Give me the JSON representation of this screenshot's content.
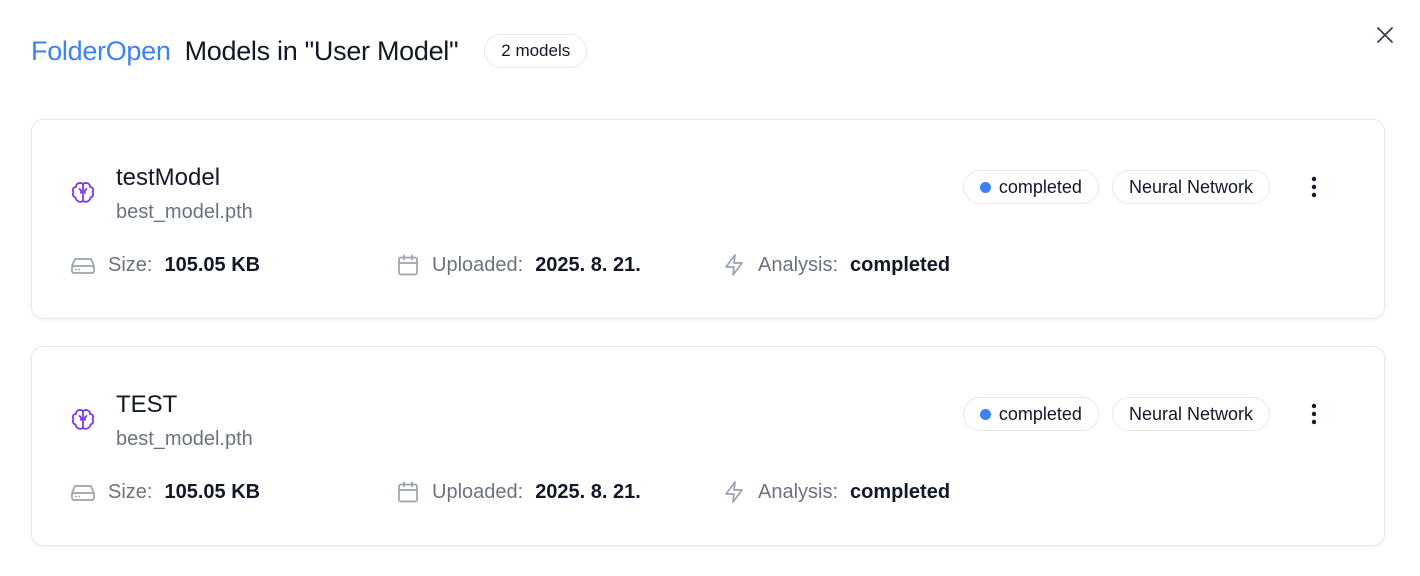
{
  "header": {
    "folder_label": "FolderOpen",
    "title": "Models in \"User Model\"",
    "count_badge": "2 models"
  },
  "icons": {
    "close": "close-icon",
    "brain": "brain-icon",
    "size": "hard-drive-icon",
    "uploaded": "calendar-icon",
    "analysis": "lightning-icon",
    "more": "more-vertical-icon"
  },
  "colors": {
    "accent": "#3b82f6",
    "brain": "#7c3aed",
    "status_dot": "#3b82f6"
  },
  "models": [
    {
      "name": "testModel",
      "file": "best_model.pth",
      "status": "completed",
      "type": "Neural Network",
      "size_label": "Size:",
      "size": "105.05 KB",
      "uploaded_label": "Uploaded:",
      "uploaded": "2025. 8. 21.",
      "analysis_label": "Analysis:",
      "analysis": "completed"
    },
    {
      "name": "TEST",
      "file": "best_model.pth",
      "status": "completed",
      "type": "Neural Network",
      "size_label": "Size:",
      "size": "105.05 KB",
      "uploaded_label": "Uploaded:",
      "uploaded": "2025. 8. 21.",
      "analysis_label": "Analysis:",
      "analysis": "completed"
    }
  ]
}
